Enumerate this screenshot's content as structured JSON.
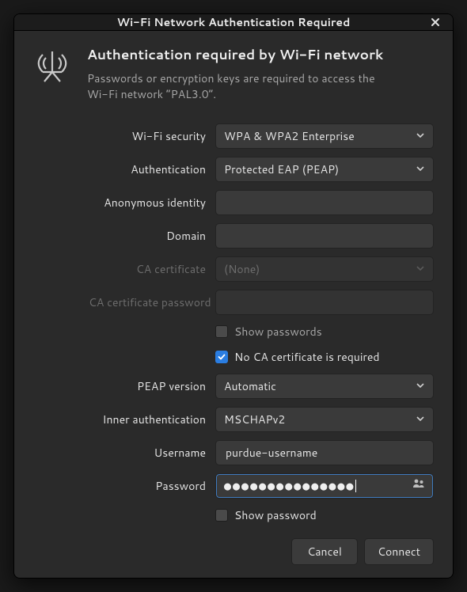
{
  "title": "Wi-Fi Network Authentication Required",
  "heading": "Authentication required by Wi-Fi network",
  "subtext": "Passwords or encryption keys are required to access the Wi-Fi network “PAL3.0”.",
  "labels": {
    "wifi_security": "Wi-Fi security",
    "authentication": "Authentication",
    "anonymous_identity": "Anonymous identity",
    "domain": "Domain",
    "ca_certificate": "CA certificate",
    "ca_cert_password": "CA certificate password",
    "show_passwords": "Show passwords",
    "no_ca_required": "No CA certificate is required",
    "peap_version": "PEAP version",
    "inner_auth": "Inner authentication",
    "username": "Username",
    "password": "Password",
    "show_password": "Show password"
  },
  "values": {
    "wifi_security": "WPA & WPA2 Enterprise",
    "authentication": "Protected EAP (PEAP)",
    "anonymous_identity": "",
    "domain": "",
    "ca_certificate": "(None)",
    "ca_cert_password": "",
    "show_passwords": false,
    "no_ca_required": true,
    "peap_version": "Automatic",
    "inner_auth": "MSCHAPv2",
    "username": "purdue-username",
    "password_masked": "●●●●●●●●●●●●●●●",
    "show_password": false
  },
  "buttons": {
    "cancel": "Cancel",
    "connect": "Connect"
  }
}
